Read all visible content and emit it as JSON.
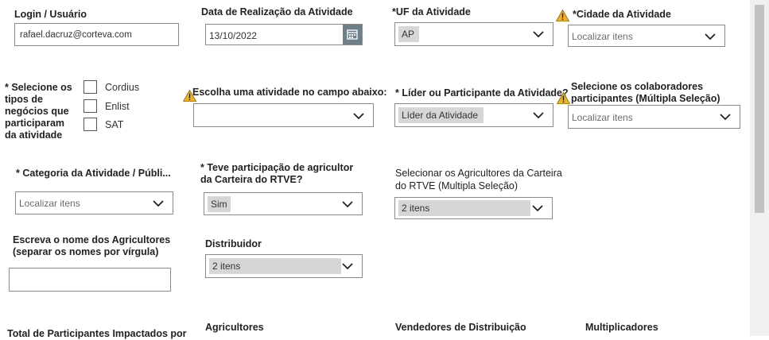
{
  "login": {
    "label": "Login / Usuário",
    "value": "rafael.dacruz@corteva.com"
  },
  "date": {
    "label": "Data de Realização da Atividade",
    "value": "13/10/2022"
  },
  "uf": {
    "label": "*UF da Atividade",
    "value": "AP"
  },
  "cidade": {
    "label": "*Cidade da Atividade",
    "placeholder": "Localizar itens"
  },
  "negocios": {
    "label": "* Selecione os tipos de negócios que participaram da atividade",
    "options": [
      "Cordius",
      "Enlist",
      "SAT"
    ]
  },
  "atividade": {
    "label": "Escolha uma atividade no campo abaixo:",
    "value": ""
  },
  "lider": {
    "label": "* Líder ou Participante da Atividade?",
    "value": "Líder da Atividade"
  },
  "colaboradores": {
    "label": "Selecione os colaboradores participantes (Múltipla Seleção)",
    "placeholder": "Localizar itens"
  },
  "categoria": {
    "label": "* Categoria da Atividade / Públi...",
    "placeholder": "Localizar itens"
  },
  "rtve_participacao": {
    "label": "* Teve participação de agricultor da Carteira do RTVE?",
    "value": "Sim"
  },
  "rtve_agricultores": {
    "label": "Selecionar os Agricultores da Carteira do RTVE (Multipla Seleção)",
    "value": "2 itens"
  },
  "nomes_agricultores": {
    "label": "Escreva o nome dos Agricultores (separar os nomes por vírgula)",
    "value": ""
  },
  "distribuidor": {
    "label": "Distribuidor",
    "value": "2 itens"
  },
  "bottom": {
    "total": "Total de Participantes Impactados por",
    "agricultores": "Agricultores",
    "vendedores": "Vendedores de Distribuição",
    "multiplicadores": "Multiplicadores"
  },
  "icons": {
    "warning": "warning-icon",
    "chevron": "chevron-down-icon",
    "calendar": "calendar-icon"
  },
  "colors": {
    "warning": "#f2b01e",
    "chip": "#d6d6d6",
    "calendar_button": "#6d7f8a"
  }
}
